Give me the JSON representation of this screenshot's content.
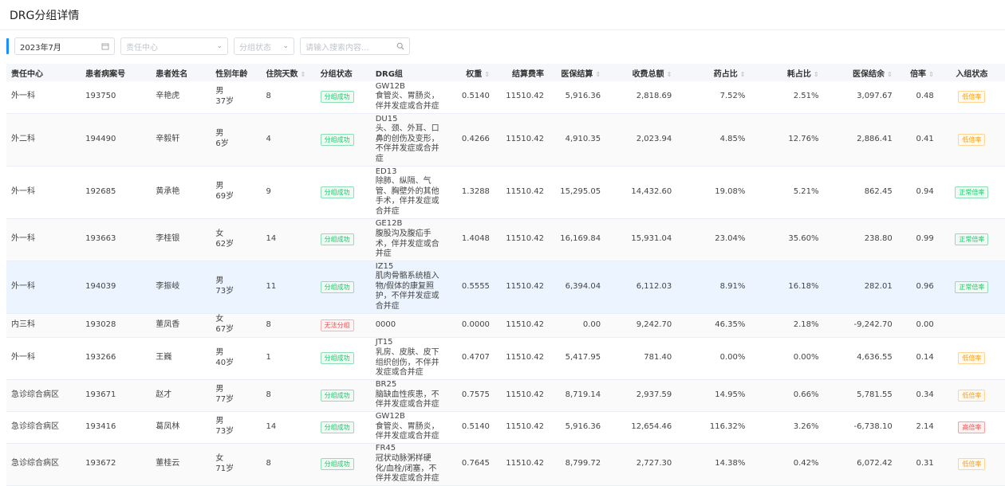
{
  "page": {
    "title": "DRG分组详情"
  },
  "filters": {
    "month": "2023年7月",
    "dept_placeholder": "责任中心",
    "status_placeholder": "分组状态",
    "search_placeholder": "请输入搜索内容..."
  },
  "columns": [
    {
      "key": "dept",
      "label": "责任中心",
      "sortable": false,
      "align": "left"
    },
    {
      "key": "record",
      "label": "患者病案号",
      "sortable": false,
      "align": "left"
    },
    {
      "key": "name",
      "label": "患者姓名",
      "sortable": false,
      "align": "left"
    },
    {
      "key": "sexage",
      "label": "性别年龄",
      "sortable": false,
      "align": "left"
    },
    {
      "key": "days",
      "label": "住院天数",
      "sortable": true,
      "align": "left"
    },
    {
      "key": "status",
      "label": "分组状态",
      "sortable": false,
      "align": "left"
    },
    {
      "key": "drg",
      "label": "DRG组",
      "sortable": false,
      "align": "left"
    },
    {
      "key": "weight",
      "label": "权重",
      "sortable": true,
      "align": "right"
    },
    {
      "key": "rate",
      "label": "结算费率",
      "sortable": false,
      "align": "right"
    },
    {
      "key": "settle",
      "label": "医保结算",
      "sortable": true,
      "align": "right"
    },
    {
      "key": "total",
      "label": "收费总额",
      "sortable": true,
      "align": "right"
    },
    {
      "key": "drug",
      "label": "药占比",
      "sortable": true,
      "align": "right"
    },
    {
      "key": "consum",
      "label": "耗占比",
      "sortable": true,
      "align": "right"
    },
    {
      "key": "balance",
      "label": "医保结余",
      "sortable": true,
      "align": "right"
    },
    {
      "key": "ratio",
      "label": "倍率",
      "sortable": true,
      "align": "right"
    },
    {
      "key": "entry",
      "label": "入组状态",
      "sortable": false,
      "align": "center"
    }
  ],
  "rows": [
    {
      "dept": "外一科",
      "record": "193750",
      "name": "辛艳虎",
      "sex": "男",
      "age": "37岁",
      "days": "8",
      "status": "分组成功",
      "statusType": "ok",
      "drg": [
        "GW12B",
        "食管炎、胃肠炎，",
        "伴并发症或合并症"
      ],
      "weight": "0.5140",
      "rate": "11510.42",
      "settle": "5,916.36",
      "total": "2,818.69",
      "drug": "7.52%",
      "consum": "2.51%",
      "balance": "3,097.67",
      "ratio": "0.48",
      "entry": "低倍率",
      "entryType": "low"
    },
    {
      "dept": "外二科",
      "record": "194490",
      "name": "辛毅轩",
      "sex": "男",
      "age": "6岁",
      "days": "4",
      "status": "分组成功",
      "statusType": "ok",
      "drg": [
        "DU15",
        "头、颈、外耳、口",
        "鼻的创伤及变形，",
        "不伴并发症或合并",
        "症"
      ],
      "weight": "0.4266",
      "rate": "11510.42",
      "settle": "4,910.35",
      "total": "2,023.94",
      "drug": "4.85%",
      "consum": "12.76%",
      "balance": "2,886.41",
      "ratio": "0.41",
      "entry": "低倍率",
      "entryType": "low"
    },
    {
      "dept": "外一科",
      "record": "192685",
      "name": "黄承艳",
      "sex": "男",
      "age": "69岁",
      "days": "9",
      "status": "分组成功",
      "statusType": "ok",
      "drg": [
        "ED13",
        "除肺、纵隔、气",
        "管、胸壁外的其他",
        "手术，伴并发症或",
        "合并症"
      ],
      "weight": "1.3288",
      "rate": "11510.42",
      "settle": "15,295.05",
      "total": "14,432.60",
      "drug": "19.08%",
      "consum": "5.21%",
      "balance": "862.45",
      "ratio": "0.94",
      "entry": "正常倍率",
      "entryType": "normal"
    },
    {
      "dept": "外一科",
      "record": "193663",
      "name": "李桂银",
      "sex": "女",
      "age": "62岁",
      "days": "14",
      "status": "分组成功",
      "statusType": "ok",
      "drg": [
        "GE12B",
        "腹股沟及腹疝手",
        "术，伴并发症或合",
        "并症"
      ],
      "weight": "1.4048",
      "rate": "11510.42",
      "settle": "16,169.84",
      "total": "15,931.04",
      "drug": "23.04%",
      "consum": "35.60%",
      "balance": "238.80",
      "ratio": "0.99",
      "entry": "正常倍率",
      "entryType": "normal"
    },
    {
      "dept": "外一科",
      "record": "194039",
      "name": "李振岐",
      "sex": "男",
      "age": "73岁",
      "days": "11",
      "status": "分组成功",
      "statusType": "ok",
      "drg": [
        "IZ15",
        "肌肉骨骼系统植入",
        "物/假体的康复照",
        "护，不伴并发症或",
        "合并症"
      ],
      "weight": "0.5555",
      "rate": "11510.42",
      "settle": "6,394.04",
      "total": "6,112.03",
      "drug": "8.91%",
      "consum": "16.18%",
      "balance": "282.01",
      "ratio": "0.96",
      "entry": "正常倍率",
      "entryType": "normal"
    },
    {
      "dept": "内三科",
      "record": "193028",
      "name": "董凤香",
      "sex": "女",
      "age": "67岁",
      "days": "8",
      "status": "无法分组",
      "statusType": "fail",
      "drg": [
        "0000"
      ],
      "weight": "0.0000",
      "rate": "11510.42",
      "settle": "0.00",
      "total": "9,242.70",
      "drug": "46.35%",
      "consum": "2.18%",
      "balance": "-9,242.70",
      "ratio": "0.00",
      "entry": "",
      "entryType": ""
    },
    {
      "dept": "外一科",
      "record": "193266",
      "name": "王巍",
      "sex": "男",
      "age": "40岁",
      "days": "1",
      "status": "分组成功",
      "statusType": "ok",
      "drg": [
        "JT15",
        "乳房、皮肤、皮下",
        "组织创伤，不伴并",
        "发症或合并症"
      ],
      "weight": "0.4707",
      "rate": "11510.42",
      "settle": "5,417.95",
      "total": "781.40",
      "drug": "0.00%",
      "consum": "0.00%",
      "balance": "4,636.55",
      "ratio": "0.14",
      "entry": "低倍率",
      "entryType": "low"
    },
    {
      "dept": "急诊综合病区",
      "record": "193671",
      "name": "赵才",
      "sex": "男",
      "age": "77岁",
      "days": "8",
      "status": "分组成功",
      "statusType": "ok",
      "drg": [
        "BR25",
        "脑缺血性疾患，不",
        "伴并发症或合并症"
      ],
      "weight": "0.7575",
      "rate": "11510.42",
      "settle": "8,719.14",
      "total": "2,937.59",
      "drug": "14.95%",
      "consum": "0.66%",
      "balance": "5,781.55",
      "ratio": "0.34",
      "entry": "低倍率",
      "entryType": "low"
    },
    {
      "dept": "急诊综合病区",
      "record": "193416",
      "name": "葛凤林",
      "sex": "男",
      "age": "73岁",
      "days": "14",
      "status": "分组成功",
      "statusType": "ok",
      "drg": [
        "GW12B",
        "食管炎、胃肠炎，",
        "伴并发症或合并症"
      ],
      "weight": "0.5140",
      "rate": "11510.42",
      "settle": "5,916.36",
      "total": "12,654.46",
      "drug": "116.32%",
      "consum": "3.26%",
      "balance": "-6,738.10",
      "ratio": "2.14",
      "entry": "高倍率",
      "entryType": "high"
    },
    {
      "dept": "急诊综合病区",
      "record": "193672",
      "name": "董桂云",
      "sex": "女",
      "age": "71岁",
      "days": "8",
      "status": "分组成功",
      "statusType": "ok",
      "drg": [
        "FR45",
        "冠状动脉粥样硬",
        "化/血栓/闭塞，不",
        "伴并发症或合并症"
      ],
      "weight": "0.7645",
      "rate": "11510.42",
      "settle": "8,799.72",
      "total": "2,727.30",
      "drug": "14.38%",
      "consum": "0.42%",
      "balance": "6,072.42",
      "ratio": "0.31",
      "entry": "低倍率",
      "entryType": "low"
    }
  ]
}
